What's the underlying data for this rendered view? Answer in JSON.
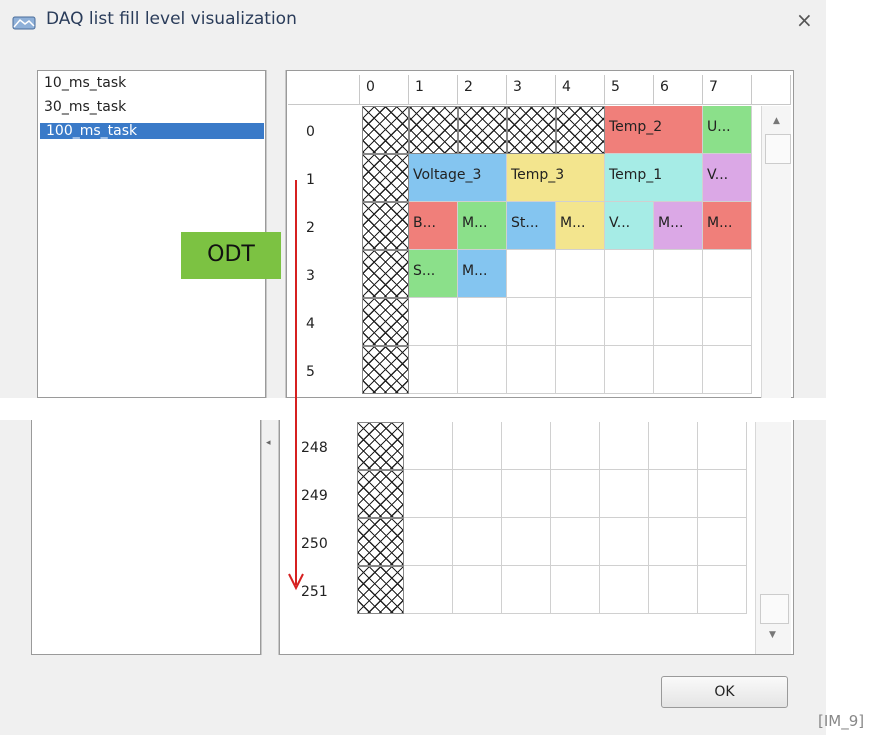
{
  "dialog": {
    "title": "DAQ list fill level visualization",
    "close_symbol": "×",
    "ok_label": "OK"
  },
  "tasks": [
    {
      "label": "10_ms_task",
      "selected": false
    },
    {
      "label": "30_ms_task",
      "selected": false
    },
    {
      "label": "100_ms_task",
      "selected": true
    }
  ],
  "grid": {
    "columns": [
      "0",
      "1",
      "2",
      "3",
      "4",
      "5",
      "6",
      "7"
    ],
    "rows_top": [
      "0",
      "1",
      "2",
      "3",
      "4",
      "5"
    ],
    "rows_bottom": [
      "248",
      "249",
      "250",
      "251"
    ],
    "cells": [
      {
        "row": 0,
        "col": 5,
        "span": 2,
        "text": "Temp_2",
        "color": "#f07f7a"
      },
      {
        "row": 0,
        "col": 7,
        "span": 1,
        "text": "U...",
        "color": "#8be08a"
      },
      {
        "row": 1,
        "col": 1,
        "span": 2,
        "text": "Voltage_3",
        "color": "#84c5f0"
      },
      {
        "row": 1,
        "col": 3,
        "span": 2,
        "text": "Temp_3",
        "color": "#f3e58e"
      },
      {
        "row": 1,
        "col": 5,
        "span": 2,
        "text": "Temp_1",
        "color": "#a6ece6"
      },
      {
        "row": 1,
        "col": 7,
        "span": 1,
        "text": "V...",
        "color": "#dba8e6"
      },
      {
        "row": 2,
        "col": 1,
        "span": 1,
        "text": "B...",
        "color": "#f07f7a"
      },
      {
        "row": 2,
        "col": 2,
        "span": 1,
        "text": "M...",
        "color": "#8be08a"
      },
      {
        "row": 2,
        "col": 3,
        "span": 1,
        "text": "St...",
        "color": "#84c5f0"
      },
      {
        "row": 2,
        "col": 4,
        "span": 1,
        "text": "M...",
        "color": "#f3e58e"
      },
      {
        "row": 2,
        "col": 5,
        "span": 1,
        "text": "V...",
        "color": "#a6ece6"
      },
      {
        "row": 2,
        "col": 6,
        "span": 1,
        "text": "M...",
        "color": "#dba8e6"
      },
      {
        "row": 2,
        "col": 7,
        "span": 1,
        "text": "M...",
        "color": "#f07f7a"
      },
      {
        "row": 3,
        "col": 1,
        "span": 1,
        "text": "S...",
        "color": "#8be08a"
      },
      {
        "row": 3,
        "col": 2,
        "span": 1,
        "text": "M...",
        "color": "#84c5f0"
      }
    ]
  },
  "annotation": {
    "odt_label": "ODT",
    "odt_color": "#7cc242",
    "arrow_color": "#d62020"
  },
  "image_label": "[IM_9]"
}
